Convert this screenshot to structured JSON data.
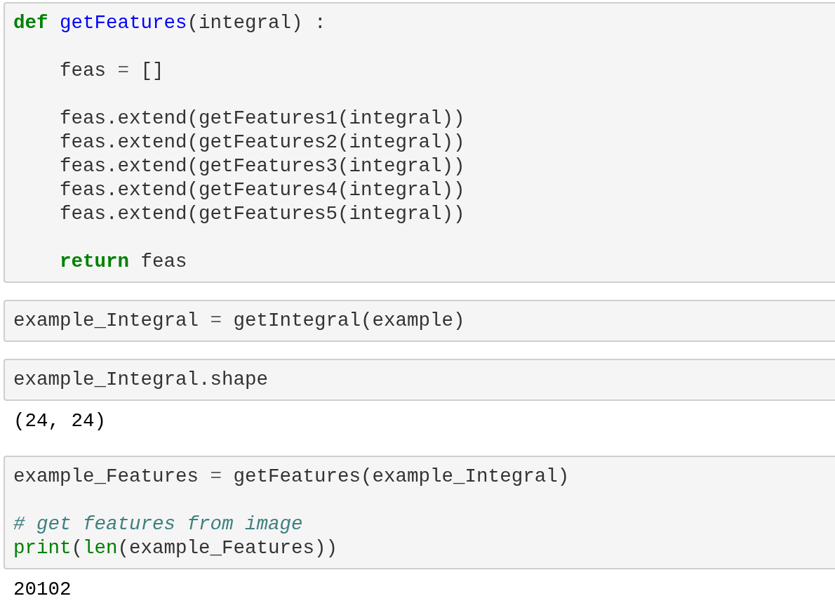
{
  "cells": [
    {
      "kind": "code",
      "lines": [
        {
          "kind": "code",
          "tokens": [
            {
              "kind": "keyword",
              "text": "def"
            },
            {
              "kind": "defname",
              "text": " getFeatures"
            },
            {
              "kind": "plain",
              "text": "(integral) :"
            }
          ]
        },
        {
          "kind": "blank"
        },
        {
          "kind": "code",
          "tokens": [
            {
              "kind": "plain",
              "text": "    feas "
            },
            {
              "kind": "operator",
              "text": "="
            },
            {
              "kind": "plain",
              "text": " []"
            }
          ]
        },
        {
          "kind": "blank"
        },
        {
          "kind": "code",
          "tokens": [
            {
              "kind": "plain",
              "text": "    feas.extend(getFeatures1(integral))"
            }
          ]
        },
        {
          "kind": "code",
          "tokens": [
            {
              "kind": "plain",
              "text": "    feas.extend(getFeatures2(integral))"
            }
          ]
        },
        {
          "kind": "code",
          "tokens": [
            {
              "kind": "plain",
              "text": "    feas.extend(getFeatures3(integral))"
            }
          ]
        },
        {
          "kind": "code",
          "tokens": [
            {
              "kind": "plain",
              "text": "    feas.extend(getFeatures4(integral))"
            }
          ]
        },
        {
          "kind": "code",
          "tokens": [
            {
              "kind": "plain",
              "text": "    feas.extend(getFeatures5(integral))"
            }
          ]
        },
        {
          "kind": "blank"
        },
        {
          "kind": "code",
          "tokens": [
            {
              "kind": "keyword",
              "text": "    return"
            },
            {
              "kind": "plain",
              "text": " feas"
            }
          ]
        }
      ]
    },
    {
      "kind": "code",
      "lines": [
        {
          "kind": "code",
          "tokens": [
            {
              "kind": "plain",
              "text": "example_Integral "
            },
            {
              "kind": "operator",
              "text": "="
            },
            {
              "kind": "plain",
              "text": " getIntegral(example)"
            }
          ]
        }
      ]
    },
    {
      "kind": "code",
      "lines": [
        {
          "kind": "code",
          "tokens": [
            {
              "kind": "plain",
              "text": "example_Integral.shape"
            }
          ]
        }
      ]
    },
    {
      "kind": "output",
      "text": "(24, 24)"
    },
    {
      "kind": "code",
      "lines": [
        {
          "kind": "code",
          "tokens": [
            {
              "kind": "plain",
              "text": "example_Features "
            },
            {
              "kind": "operator",
              "text": "="
            },
            {
              "kind": "plain",
              "text": " getFeatures(example_Integral)"
            }
          ]
        },
        {
          "kind": "blank"
        },
        {
          "kind": "code",
          "tokens": [
            {
              "kind": "comment",
              "text": "# get features from image"
            }
          ]
        },
        {
          "kind": "code",
          "tokens": [
            {
              "kind": "builtin",
              "text": "print"
            },
            {
              "kind": "plain",
              "text": "("
            },
            {
              "kind": "builtin",
              "text": "len"
            },
            {
              "kind": "plain",
              "text": "(example_Features))"
            }
          ]
        }
      ]
    },
    {
      "kind": "output",
      "text": "20102"
    }
  ]
}
